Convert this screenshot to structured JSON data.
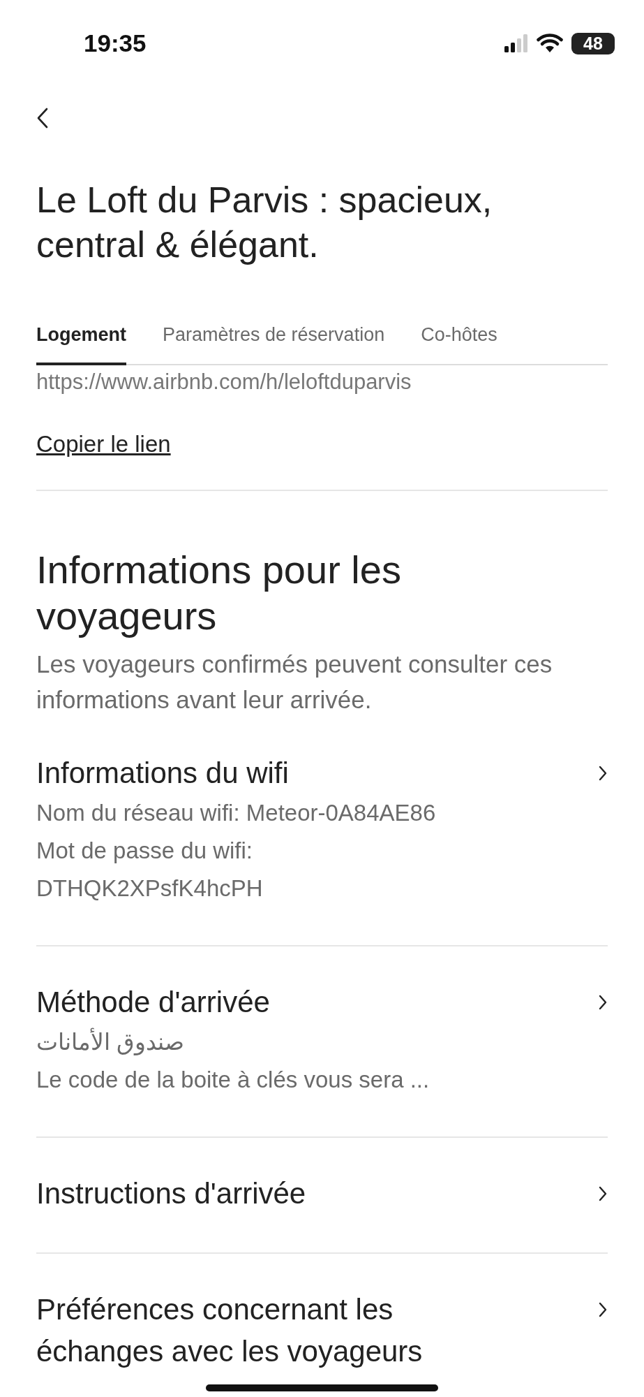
{
  "status_bar": {
    "time": "19:35",
    "battery": "48"
  },
  "title": "Le Loft du Parvis : spacieux, central & élégant.",
  "tabs": [
    {
      "label": "Logement",
      "selected": true
    },
    {
      "label": "Paramètres de réservation",
      "selected": false
    },
    {
      "label": "Co-hôtes",
      "selected": false
    }
  ],
  "link": {
    "url": "https://www.airbnb.com/h/leloftduparvis",
    "action": "Copier le lien"
  },
  "section": {
    "title": "Informations pour les voyageurs",
    "description": "Les voyageurs confirmés peuvent consulter ces informations avant leur arrivée."
  },
  "items": [
    {
      "title": "Informations du wifi",
      "lines": [
        "Nom du réseau wifi: Meteor-0A84AE86",
        "Mot de passe du wifi:",
        "DTHQK2XPsfK4hcPH"
      ]
    },
    {
      "title": "Méthode d'arrivée",
      "lines": [
        "صندوق الأمانات",
        "Le code de la boite à clés vous sera ..."
      ]
    },
    {
      "title": "Instructions d'arrivée"
    },
    {
      "title": "Préférences concernant les échanges avec les voyageurs"
    }
  ]
}
